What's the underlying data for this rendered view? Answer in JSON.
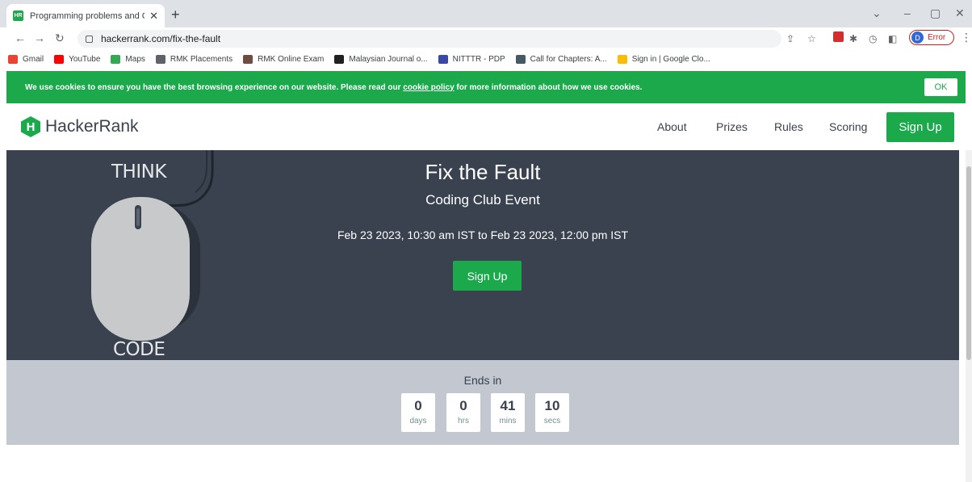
{
  "browser": {
    "tab_title": "Programming problems and Cor",
    "tab_favicon_text": "HR",
    "url": "hackerrank.com/fix-the-fault",
    "profile_initial": "D",
    "profile_status": "Error",
    "bookmarks": [
      {
        "label": "Gmail",
        "color": "#ea4335"
      },
      {
        "label": "YouTube",
        "color": "#ff0000"
      },
      {
        "label": "Maps",
        "color": "#34a853"
      },
      {
        "label": "RMK Placements",
        "color": "#5f6368"
      },
      {
        "label": "RMK Online Exam",
        "color": "#6d4c41"
      },
      {
        "label": "Malaysian Journal o...",
        "color": "#212121"
      },
      {
        "label": "NITTTR - PDP",
        "color": "#3949ab"
      },
      {
        "label": "Call for Chapters: A...",
        "color": "#455a64"
      },
      {
        "label": "Sign in | Google Clo...",
        "color": "#fbbc04"
      }
    ]
  },
  "cookie": {
    "text_before": "We use cookies to ensure you have the best browsing experience on our website. Please read our ",
    "link": "cookie policy",
    "text_after": " for more information about how we use cookies.",
    "ok_label": "OK"
  },
  "site": {
    "logo_mark": "H",
    "logo_name": "HackerRank",
    "nav": [
      "About",
      "Prizes",
      "Rules",
      "Scoring"
    ],
    "signup_label": "Sign Up"
  },
  "hero": {
    "think": "THINK",
    "code": "CODE",
    "title": "Fix the Fault",
    "subtitle": "Coding Club Event",
    "date_range": "Feb 23 2023, 10:30 am IST to Feb 23 2023, 12:00 pm IST",
    "signup_label": "Sign Up"
  },
  "countdown": {
    "label": "Ends in",
    "units": [
      {
        "value": "0",
        "unit": "days"
      },
      {
        "value": "0",
        "unit": "hrs"
      },
      {
        "value": "41",
        "unit": "mins"
      },
      {
        "value": "10",
        "unit": "secs"
      }
    ]
  },
  "colors": {
    "brand_green": "#1ba94c",
    "hero_bg": "#39424e",
    "countdown_bg": "#c2c7d0"
  }
}
